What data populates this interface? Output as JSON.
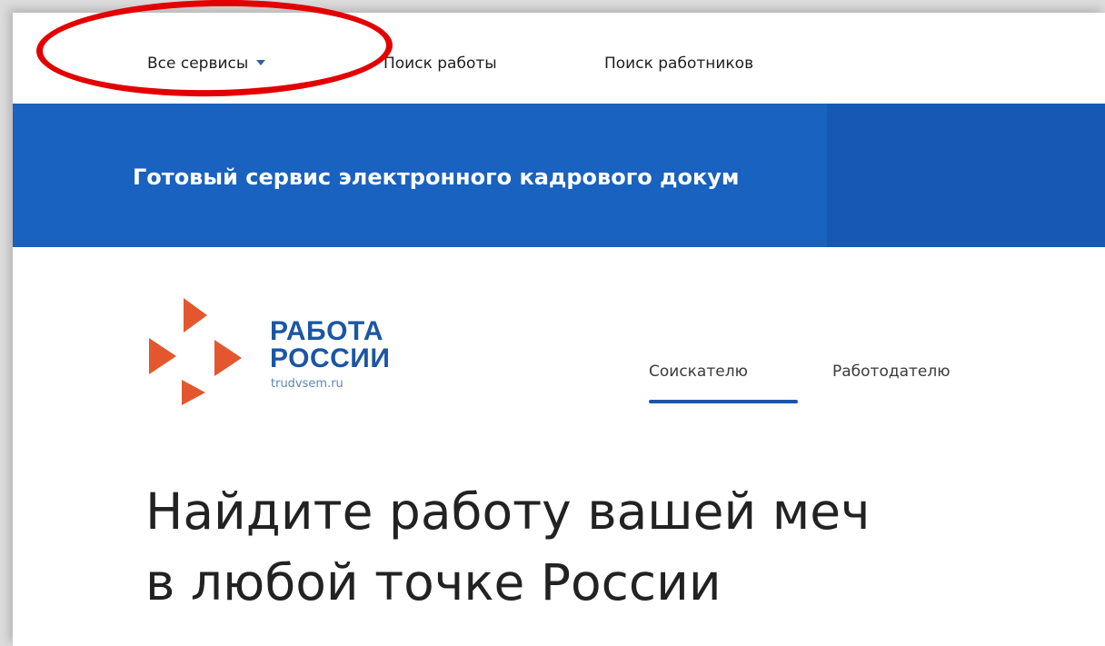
{
  "top_nav": {
    "all_services": "Все сервисы",
    "job_search": "Поиск работы",
    "worker_search": "Поиск работников"
  },
  "banner": {
    "text": "Готовый сервис электронного кадрового докум"
  },
  "logo": {
    "line1": "РАБОТА",
    "line2": "РОССИИ",
    "url": "trudvsem.ru"
  },
  "tabs": [
    {
      "label": "Соискателю",
      "active": true
    },
    {
      "label": "Работодателю",
      "active": false
    }
  ],
  "headline": {
    "line1": "Найдите работу вашей меч",
    "line2": "в любой точке России"
  },
  "colors": {
    "brand_blue": "#1b56a4",
    "banner_blue": "#1a62bf",
    "logo_orange": "#e4572e",
    "annotation_red": "#e20000"
  },
  "icons": {
    "dropdown": "caret-down-icon",
    "logo": "arrows-logo-icon"
  }
}
